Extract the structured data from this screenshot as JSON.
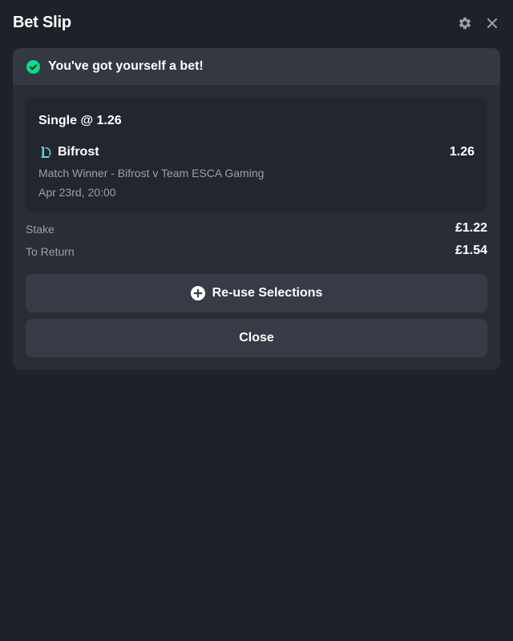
{
  "header": {
    "title": "Bet Slip",
    "settings_icon": "gear-icon",
    "close_icon": "close-icon"
  },
  "confirmation": {
    "icon": "check-circle-icon",
    "message": "You've got yourself a bet!",
    "accent_color": "#00e28b"
  },
  "bet": {
    "type_label": "Single @ 1.26",
    "selection": {
      "game_icon": "league-of-legends-icon",
      "name": "Bifrost",
      "odds": "1.26",
      "market": "Match Winner - Bifrost v Team ESCA Gaming",
      "start_time": "Apr 23rd, 20:00"
    }
  },
  "summary": {
    "stake_label": "Stake",
    "stake_value": "£1.22",
    "return_label": "To Return",
    "return_value": "£1.54"
  },
  "actions": {
    "reuse_icon": "plus-circle-icon",
    "reuse_label": "Re-use Selections",
    "close_label": "Close"
  }
}
